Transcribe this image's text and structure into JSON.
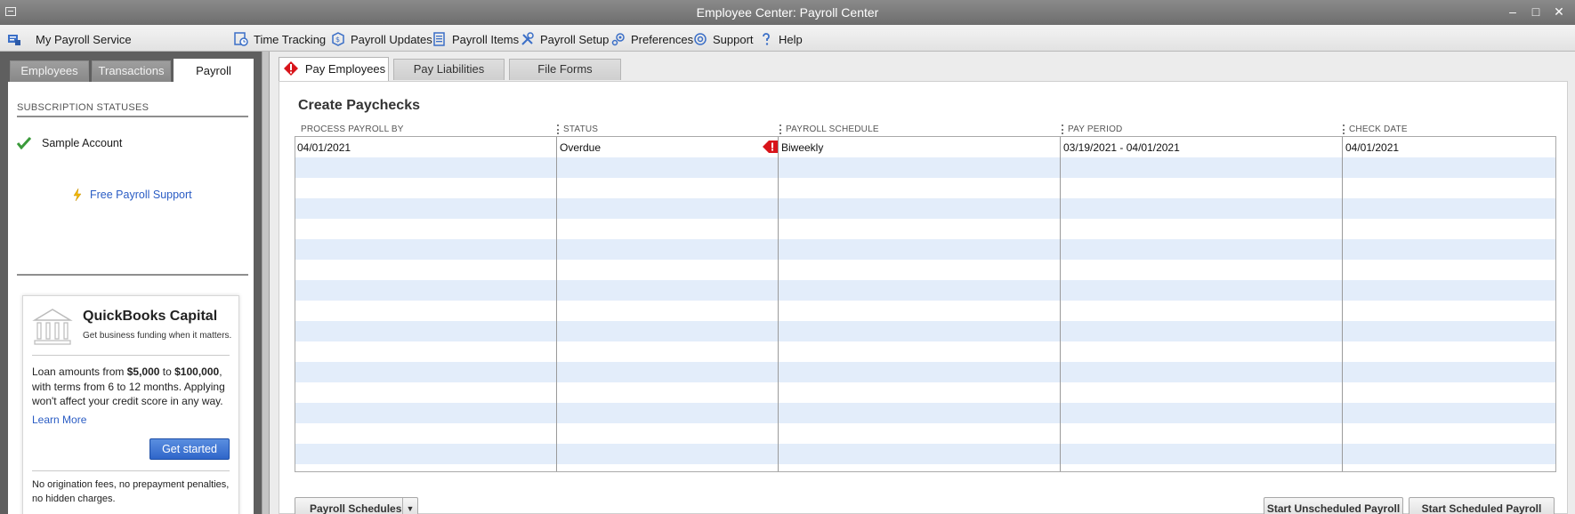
{
  "window": {
    "title": "Employee Center: Payroll Center",
    "buttons": {
      "minimize": "‒",
      "restore": "□",
      "close": "✕"
    }
  },
  "toolbar": {
    "items": [
      {
        "label": "My Payroll Service",
        "icon": "payroll-service-icon"
      },
      {
        "label": "Time Tracking",
        "icon": "time-tracking-icon"
      },
      {
        "label": "Payroll Updates",
        "icon": "payroll-updates-icon"
      },
      {
        "label": "Payroll Items",
        "icon": "payroll-items-icon"
      },
      {
        "label": "Payroll Setup",
        "icon": "payroll-setup-icon"
      },
      {
        "label": "Preferences",
        "icon": "preferences-icon"
      },
      {
        "label": "Support",
        "icon": "support-icon"
      },
      {
        "label": "Help",
        "icon": "help-icon"
      }
    ]
  },
  "left": {
    "tabs": [
      {
        "label": "Employees",
        "active": false
      },
      {
        "label": "Transactions",
        "active": false
      },
      {
        "label": "Payroll",
        "active": true
      }
    ],
    "subscription_header": "SUBSCRIPTION STATUSES",
    "account_name": "Sample Account",
    "support_link": "Free Payroll Support",
    "capital": {
      "title": "QuickBooks Capital",
      "subtitle": "Get business funding when it matters.",
      "body_1": "Loan amounts from ",
      "amount_from": "$5,000",
      "body_2": " to ",
      "amount_to": "$100,000",
      "body_3": ", with terms from 6 to 12 months. Applying won't affect your credit score in any way.",
      "learn_more": "Learn More",
      "cta": "Get started",
      "footer": "No origination fees, no prepayment penalties, no hidden charges."
    }
  },
  "main": {
    "tabs": [
      {
        "label": "Pay Employees",
        "active": true,
        "warning": true
      },
      {
        "label": "Pay Liabilities",
        "active": false
      },
      {
        "label": "File Forms",
        "active": false
      }
    ],
    "title": "Create Paychecks",
    "columns": [
      "PROCESS PAYROLL BY",
      "STATUS",
      "PAYROLL SCHEDULE",
      "PAY PERIOD",
      "CHECK DATE"
    ],
    "rows": [
      {
        "process_by": "04/01/2021",
        "status": "Overdue",
        "warning": true,
        "schedule": "Biweekly",
        "period": "03/19/2021 - 04/01/2021",
        "check_date": "04/01/2021"
      }
    ],
    "buttons": {
      "schedules": "Payroll Schedules",
      "unscheduled": "Start Unscheduled Payroll",
      "scheduled": "Start Scheduled Payroll"
    }
  },
  "colors": {
    "accent_blue": "#2f66c9",
    "warning_red": "#d8141a",
    "row_stripe": "#e3edfa"
  }
}
